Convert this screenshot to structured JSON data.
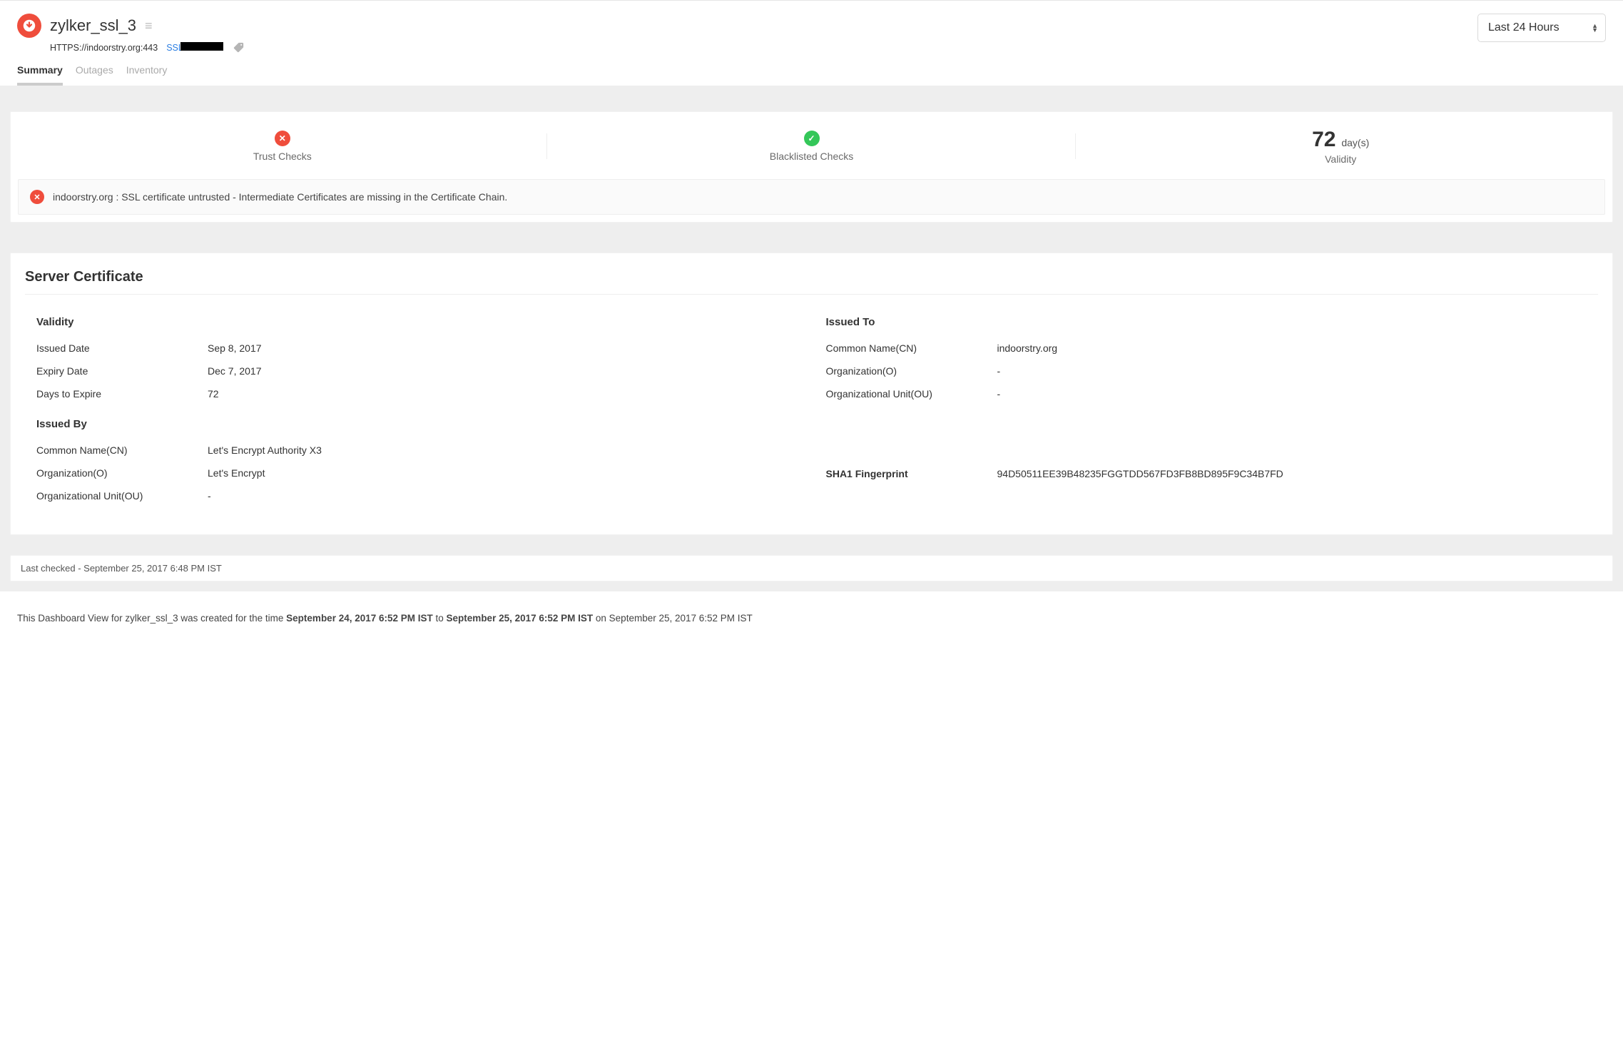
{
  "header": {
    "title": "zylker_ssl_3",
    "url": "HTTPS://indoorstry.org:443",
    "cert_link_prefix": "SSL",
    "time_range": "Last 24 Hours"
  },
  "tabs": [
    {
      "label": "Summary",
      "active": true
    },
    {
      "label": "Outages",
      "active": false
    },
    {
      "label": "Inventory",
      "active": false
    }
  ],
  "checks": {
    "trust_label": "Trust Checks",
    "blacklist_label": "Blacklisted Checks",
    "validity_value": "72",
    "validity_unit": "day(s)",
    "validity_label": "Validity"
  },
  "alert_text": "indoorstry.org : SSL certificate untrusted - Intermediate Certificates are missing in the Certificate Chain.",
  "cert_section_title": "Server Certificate",
  "validity": {
    "title": "Validity",
    "issued_date_k": "Issued Date",
    "issued_date_v": "Sep 8, 2017",
    "expiry_date_k": "Expiry Date",
    "expiry_date_v": "Dec 7, 2017",
    "days_k": "Days to Expire",
    "days_v": "72"
  },
  "issued_by": {
    "title": "Issued By",
    "cn_k": "Common Name(CN)",
    "cn_v": "Let's Encrypt Authority X3",
    "o_k": "Organization(O)",
    "o_v": "Let's Encrypt",
    "ou_k": "Organizational Unit(OU)",
    "ou_v": "-"
  },
  "issued_to": {
    "title": "Issued To",
    "cn_k": "Common Name(CN)",
    "cn_v": "indoorstry.org",
    "o_k": "Organization(O)",
    "o_v": "-",
    "ou_k": "Organizational Unit(OU)",
    "ou_v": "-"
  },
  "sha1": {
    "k": "SHA1 Fingerprint",
    "v": "94D50511EE39B48235FGGTDD567FD3FB8BD895F9C34B7FD"
  },
  "last_checked": "Last checked - September 25, 2017 6:48 PM IST",
  "footer": {
    "prefix": "This Dashboard View for zylker_ssl_3  was created for the time ",
    "start": "September 24, 2017 6:52 PM IST",
    "to": " to ",
    "end": "September 25, 2017 6:52 PM IST",
    "suffix": " on September 25, 2017 6:52 PM IST"
  }
}
